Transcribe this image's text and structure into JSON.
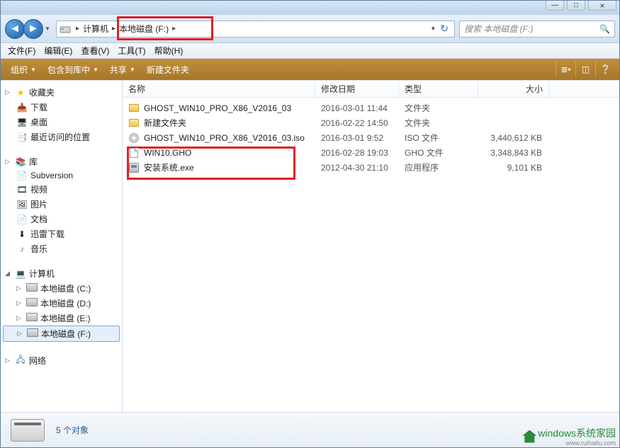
{
  "window": {
    "min_label": "—",
    "max_label": "□",
    "close_label": "×"
  },
  "breadcrumb": {
    "seg_computer": "计算机",
    "seg_drive": "本地磁盘 (F:)"
  },
  "search": {
    "placeholder": "搜索 本地磁盘 (F:)"
  },
  "menubar": {
    "file": "文件(F)",
    "edit": "编辑(E)",
    "view": "查看(V)",
    "tools": "工具(T)",
    "help": "帮助(H)"
  },
  "toolbar": {
    "organize": "组织",
    "include": "包含到库中",
    "share": "共享",
    "newfolder": "新建文件夹"
  },
  "columns": {
    "name": "名称",
    "date": "修改日期",
    "type": "类型",
    "size": "大小"
  },
  "tree": {
    "favorites": "收藏夹",
    "downloads": "下载",
    "desktop": "桌面",
    "recent": "最近访问的位置",
    "libraries": "库",
    "subversion": "Subversion",
    "videos": "视频",
    "pictures": "图片",
    "documents": "文档",
    "xunlei": "迅雷下载",
    "music": "音乐",
    "computer": "计算机",
    "drive_c": "本地磁盘 (C:)",
    "drive_d": "本地磁盘 (D:)",
    "drive_e": "本地磁盘 (E:)",
    "drive_f": "本地磁盘 (F:)",
    "network": "网络"
  },
  "files": [
    {
      "name": "GHOST_WIN10_PRO_X86_V2016_03",
      "date": "2016-03-01 11:44",
      "type": "文件夹",
      "size": "",
      "icon": "folder"
    },
    {
      "name": "新建文件夹",
      "date": "2016-02-22 14:50",
      "type": "文件夹",
      "size": "",
      "icon": "folder"
    },
    {
      "name": "GHOST_WIN10_PRO_X86_V2016_03.iso",
      "date": "2016-03-01 9:52",
      "type": "ISO 文件",
      "size": "3,440,612 KB",
      "icon": "iso"
    },
    {
      "name": "WIN10.GHO",
      "date": "2016-02-28 19:03",
      "type": "GHO 文件",
      "size": "3,348,843 KB",
      "icon": "file"
    },
    {
      "name": "安装系统.exe",
      "date": "2012-04-30 21:10",
      "type": "应用程序",
      "size": "9,101 KB",
      "icon": "exe"
    }
  ],
  "status": {
    "count_text": "5 个对象"
  },
  "watermark": {
    "main": "windows系统家园",
    "sub": "www.ruihaitu.com"
  }
}
